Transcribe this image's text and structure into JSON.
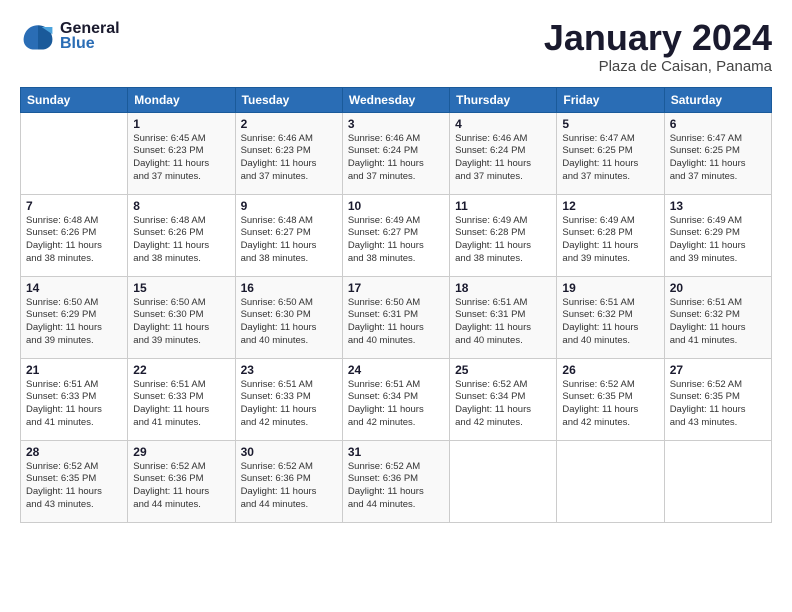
{
  "header": {
    "logo_line1": "General",
    "logo_line2": "Blue",
    "title": "January 2024",
    "subtitle": "Plaza de Caisan, Panama"
  },
  "weekdays": [
    "Sunday",
    "Monday",
    "Tuesday",
    "Wednesday",
    "Thursday",
    "Friday",
    "Saturday"
  ],
  "weeks": [
    [
      {
        "num": "",
        "info": ""
      },
      {
        "num": "1",
        "info": "Sunrise: 6:45 AM\nSunset: 6:23 PM\nDaylight: 11 hours\nand 37 minutes."
      },
      {
        "num": "2",
        "info": "Sunrise: 6:46 AM\nSunset: 6:23 PM\nDaylight: 11 hours\nand 37 minutes."
      },
      {
        "num": "3",
        "info": "Sunrise: 6:46 AM\nSunset: 6:24 PM\nDaylight: 11 hours\nand 37 minutes."
      },
      {
        "num": "4",
        "info": "Sunrise: 6:46 AM\nSunset: 6:24 PM\nDaylight: 11 hours\nand 37 minutes."
      },
      {
        "num": "5",
        "info": "Sunrise: 6:47 AM\nSunset: 6:25 PM\nDaylight: 11 hours\nand 37 minutes."
      },
      {
        "num": "6",
        "info": "Sunrise: 6:47 AM\nSunset: 6:25 PM\nDaylight: 11 hours\nand 37 minutes."
      }
    ],
    [
      {
        "num": "7",
        "info": "Sunrise: 6:48 AM\nSunset: 6:26 PM\nDaylight: 11 hours\nand 38 minutes."
      },
      {
        "num": "8",
        "info": "Sunrise: 6:48 AM\nSunset: 6:26 PM\nDaylight: 11 hours\nand 38 minutes."
      },
      {
        "num": "9",
        "info": "Sunrise: 6:48 AM\nSunset: 6:27 PM\nDaylight: 11 hours\nand 38 minutes."
      },
      {
        "num": "10",
        "info": "Sunrise: 6:49 AM\nSunset: 6:27 PM\nDaylight: 11 hours\nand 38 minutes."
      },
      {
        "num": "11",
        "info": "Sunrise: 6:49 AM\nSunset: 6:28 PM\nDaylight: 11 hours\nand 38 minutes."
      },
      {
        "num": "12",
        "info": "Sunrise: 6:49 AM\nSunset: 6:28 PM\nDaylight: 11 hours\nand 39 minutes."
      },
      {
        "num": "13",
        "info": "Sunrise: 6:49 AM\nSunset: 6:29 PM\nDaylight: 11 hours\nand 39 minutes."
      }
    ],
    [
      {
        "num": "14",
        "info": "Sunrise: 6:50 AM\nSunset: 6:29 PM\nDaylight: 11 hours\nand 39 minutes."
      },
      {
        "num": "15",
        "info": "Sunrise: 6:50 AM\nSunset: 6:30 PM\nDaylight: 11 hours\nand 39 minutes."
      },
      {
        "num": "16",
        "info": "Sunrise: 6:50 AM\nSunset: 6:30 PM\nDaylight: 11 hours\nand 40 minutes."
      },
      {
        "num": "17",
        "info": "Sunrise: 6:50 AM\nSunset: 6:31 PM\nDaylight: 11 hours\nand 40 minutes."
      },
      {
        "num": "18",
        "info": "Sunrise: 6:51 AM\nSunset: 6:31 PM\nDaylight: 11 hours\nand 40 minutes."
      },
      {
        "num": "19",
        "info": "Sunrise: 6:51 AM\nSunset: 6:32 PM\nDaylight: 11 hours\nand 40 minutes."
      },
      {
        "num": "20",
        "info": "Sunrise: 6:51 AM\nSunset: 6:32 PM\nDaylight: 11 hours\nand 41 minutes."
      }
    ],
    [
      {
        "num": "21",
        "info": "Sunrise: 6:51 AM\nSunset: 6:33 PM\nDaylight: 11 hours\nand 41 minutes."
      },
      {
        "num": "22",
        "info": "Sunrise: 6:51 AM\nSunset: 6:33 PM\nDaylight: 11 hours\nand 41 minutes."
      },
      {
        "num": "23",
        "info": "Sunrise: 6:51 AM\nSunset: 6:33 PM\nDaylight: 11 hours\nand 42 minutes."
      },
      {
        "num": "24",
        "info": "Sunrise: 6:51 AM\nSunset: 6:34 PM\nDaylight: 11 hours\nand 42 minutes."
      },
      {
        "num": "25",
        "info": "Sunrise: 6:52 AM\nSunset: 6:34 PM\nDaylight: 11 hours\nand 42 minutes."
      },
      {
        "num": "26",
        "info": "Sunrise: 6:52 AM\nSunset: 6:35 PM\nDaylight: 11 hours\nand 42 minutes."
      },
      {
        "num": "27",
        "info": "Sunrise: 6:52 AM\nSunset: 6:35 PM\nDaylight: 11 hours\nand 43 minutes."
      }
    ],
    [
      {
        "num": "28",
        "info": "Sunrise: 6:52 AM\nSunset: 6:35 PM\nDaylight: 11 hours\nand 43 minutes."
      },
      {
        "num": "29",
        "info": "Sunrise: 6:52 AM\nSunset: 6:36 PM\nDaylight: 11 hours\nand 44 minutes."
      },
      {
        "num": "30",
        "info": "Sunrise: 6:52 AM\nSunset: 6:36 PM\nDaylight: 11 hours\nand 44 minutes."
      },
      {
        "num": "31",
        "info": "Sunrise: 6:52 AM\nSunset: 6:36 PM\nDaylight: 11 hours\nand 44 minutes."
      },
      {
        "num": "",
        "info": ""
      },
      {
        "num": "",
        "info": ""
      },
      {
        "num": "",
        "info": ""
      }
    ]
  ]
}
